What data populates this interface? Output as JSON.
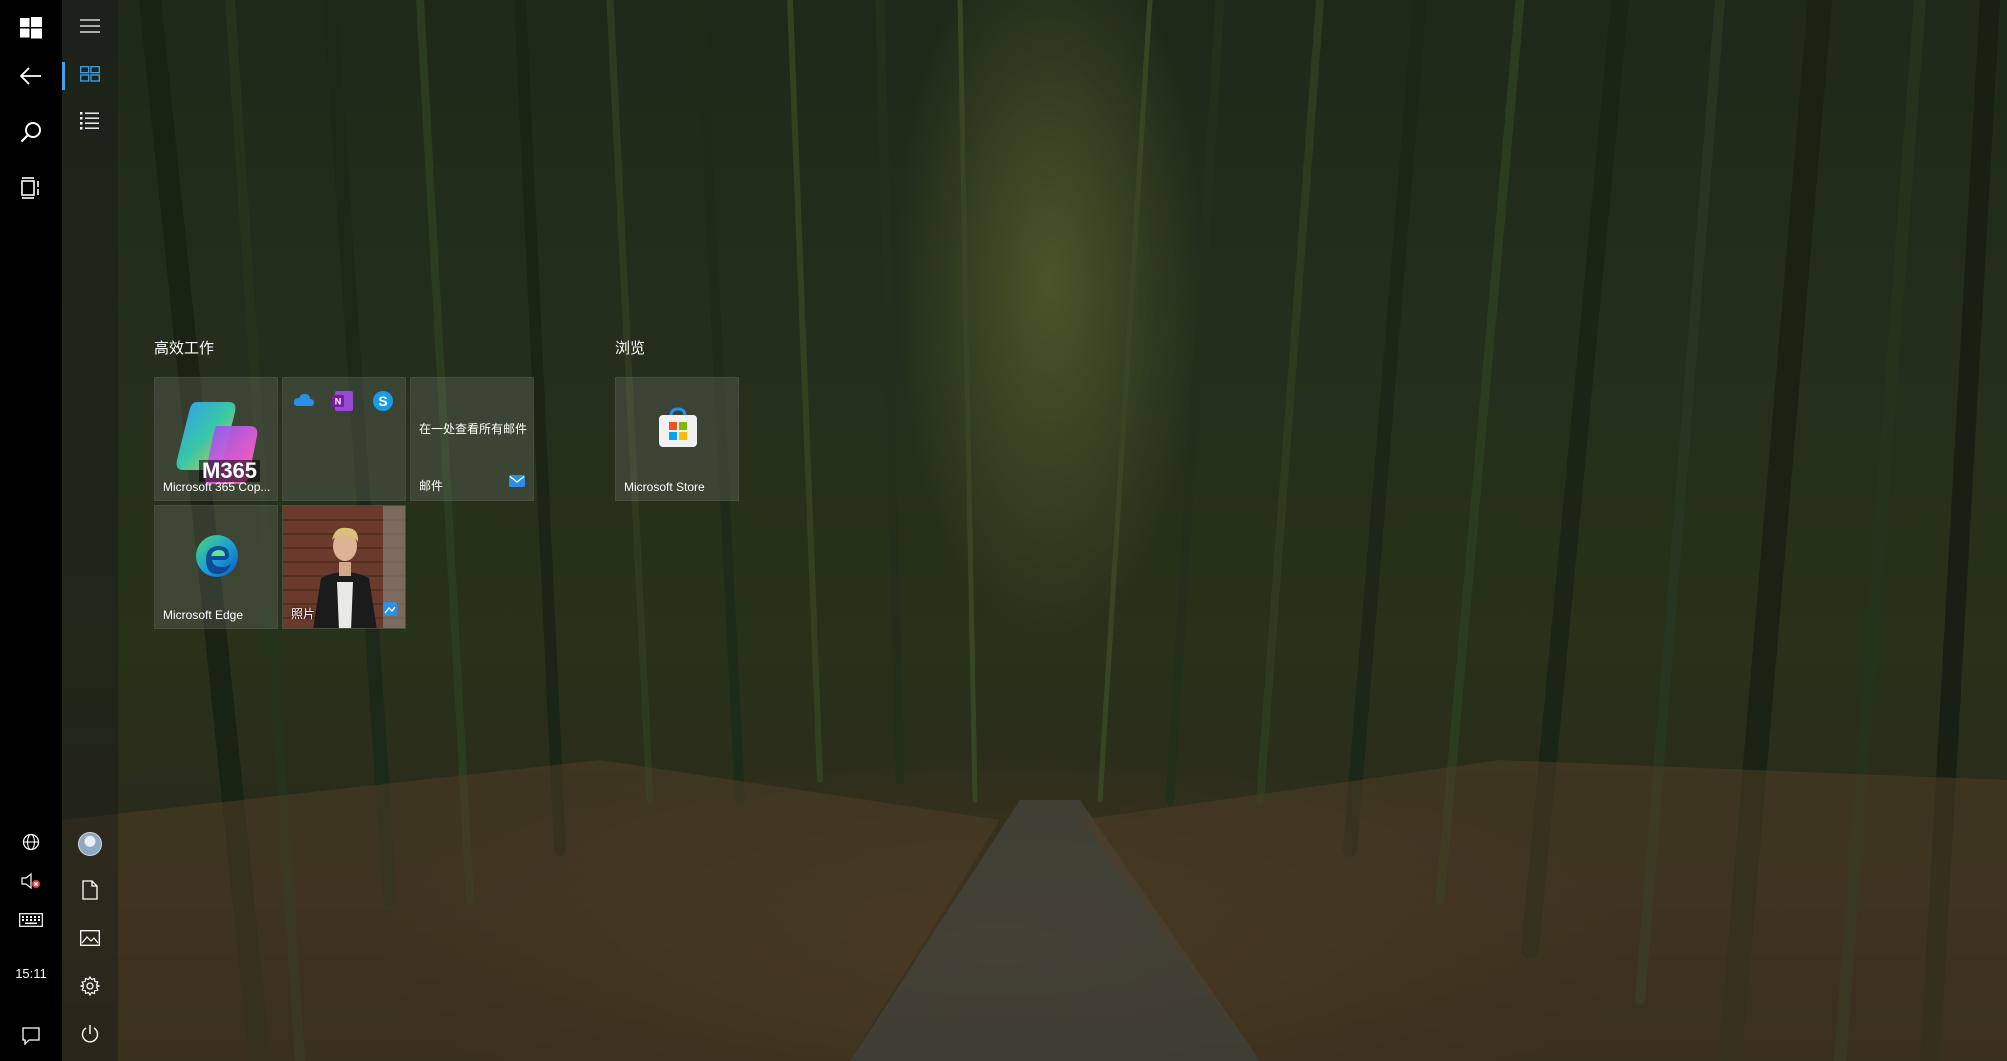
{
  "taskbar": {
    "start_icon": "windows-logo-icon",
    "back_icon": "back-arrow-icon",
    "search_icon": "search-icon",
    "task_view_icon": "task-view-icon",
    "language_icon": "globe-icon",
    "volume_icon": "volume-muted-icon",
    "keyboard_icon": "keyboard-icon",
    "clock": "15:11",
    "notification_icon": "notification-icon"
  },
  "start_rail": {
    "menu_icon": "hamburger-icon",
    "tiles_view_icon": "tiles-view-icon",
    "all_apps_icon": "list-view-icon",
    "account_icon": "avatar",
    "documents_icon": "document-icon",
    "pictures_icon": "pictures-icon",
    "settings_icon": "gear-icon",
    "power_icon": "power-icon"
  },
  "groups": [
    {
      "title": "高效工作",
      "tiles": [
        {
          "label": "Microsoft 365 Cop...",
          "badge": "M365",
          "icon": "m365-copilot-icon"
        },
        {
          "label": "",
          "icons": [
            "onedrive-icon",
            "onenote-icon",
            "skype-icon"
          ]
        },
        {
          "label": "邮件",
          "text": "在一处查看所有邮件",
          "icon": "mail-icon"
        },
        {
          "label": "Microsoft Edge",
          "icon": "edge-icon"
        },
        {
          "label": "照片",
          "icon": "photos-icon"
        }
      ]
    },
    {
      "title": "浏览",
      "tiles": [
        {
          "label": "Microsoft Store",
          "icon": "store-icon"
        }
      ]
    }
  ]
}
